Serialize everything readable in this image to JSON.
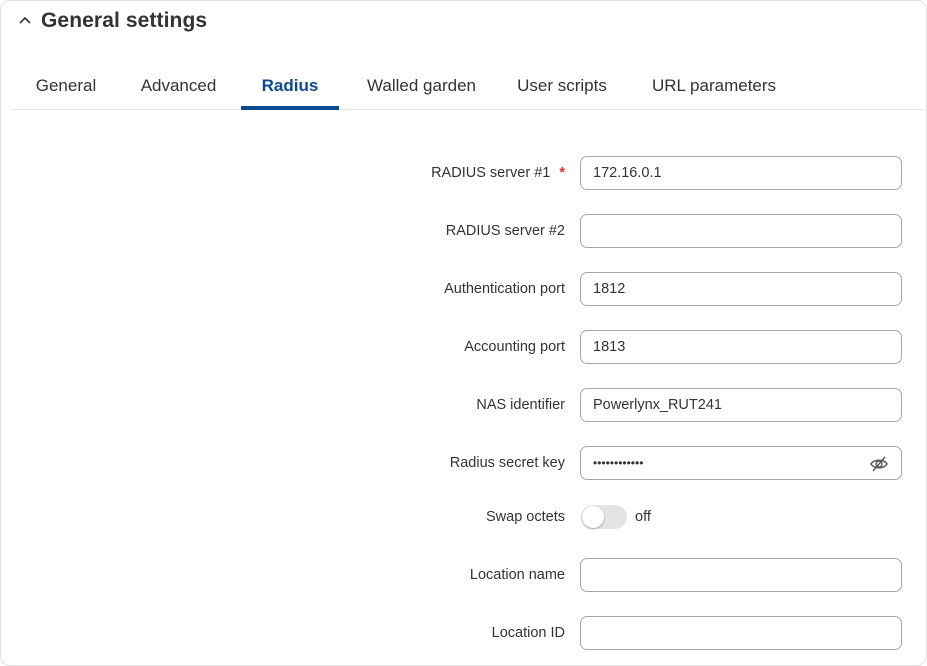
{
  "section": {
    "title": "General settings",
    "collapse_icon": "chevron-up-icon"
  },
  "tabs": [
    {
      "label": "General",
      "active": false
    },
    {
      "label": "Advanced",
      "active": false
    },
    {
      "label": "Radius",
      "active": true
    },
    {
      "label": "Walled garden",
      "active": false
    },
    {
      "label": "User scripts",
      "active": false
    },
    {
      "label": "URL parameters",
      "active": false
    }
  ],
  "form": {
    "radius_server_1": {
      "label": "RADIUS server #1",
      "required_mark": "*",
      "value": "172.16.0.1"
    },
    "radius_server_2": {
      "label": "RADIUS server #2",
      "value": ""
    },
    "auth_port": {
      "label": "Authentication port",
      "value": "1812"
    },
    "acct_port": {
      "label": "Accounting port",
      "value": "1813"
    },
    "nas_identifier": {
      "label": "NAS identifier",
      "value": "Powerlynx_RUT241"
    },
    "secret_key": {
      "label": "Radius secret key",
      "masked_value": "••••••••••••",
      "toggle_icon": "eye-slash-icon"
    },
    "swap_octets": {
      "label": "Swap octets",
      "state": "off"
    },
    "location_name": {
      "label": "Location name",
      "value": ""
    },
    "location_id": {
      "label": "Location ID",
      "value": ""
    }
  },
  "colors": {
    "accent": "#0e4a8f",
    "required": "#e0302f"
  }
}
